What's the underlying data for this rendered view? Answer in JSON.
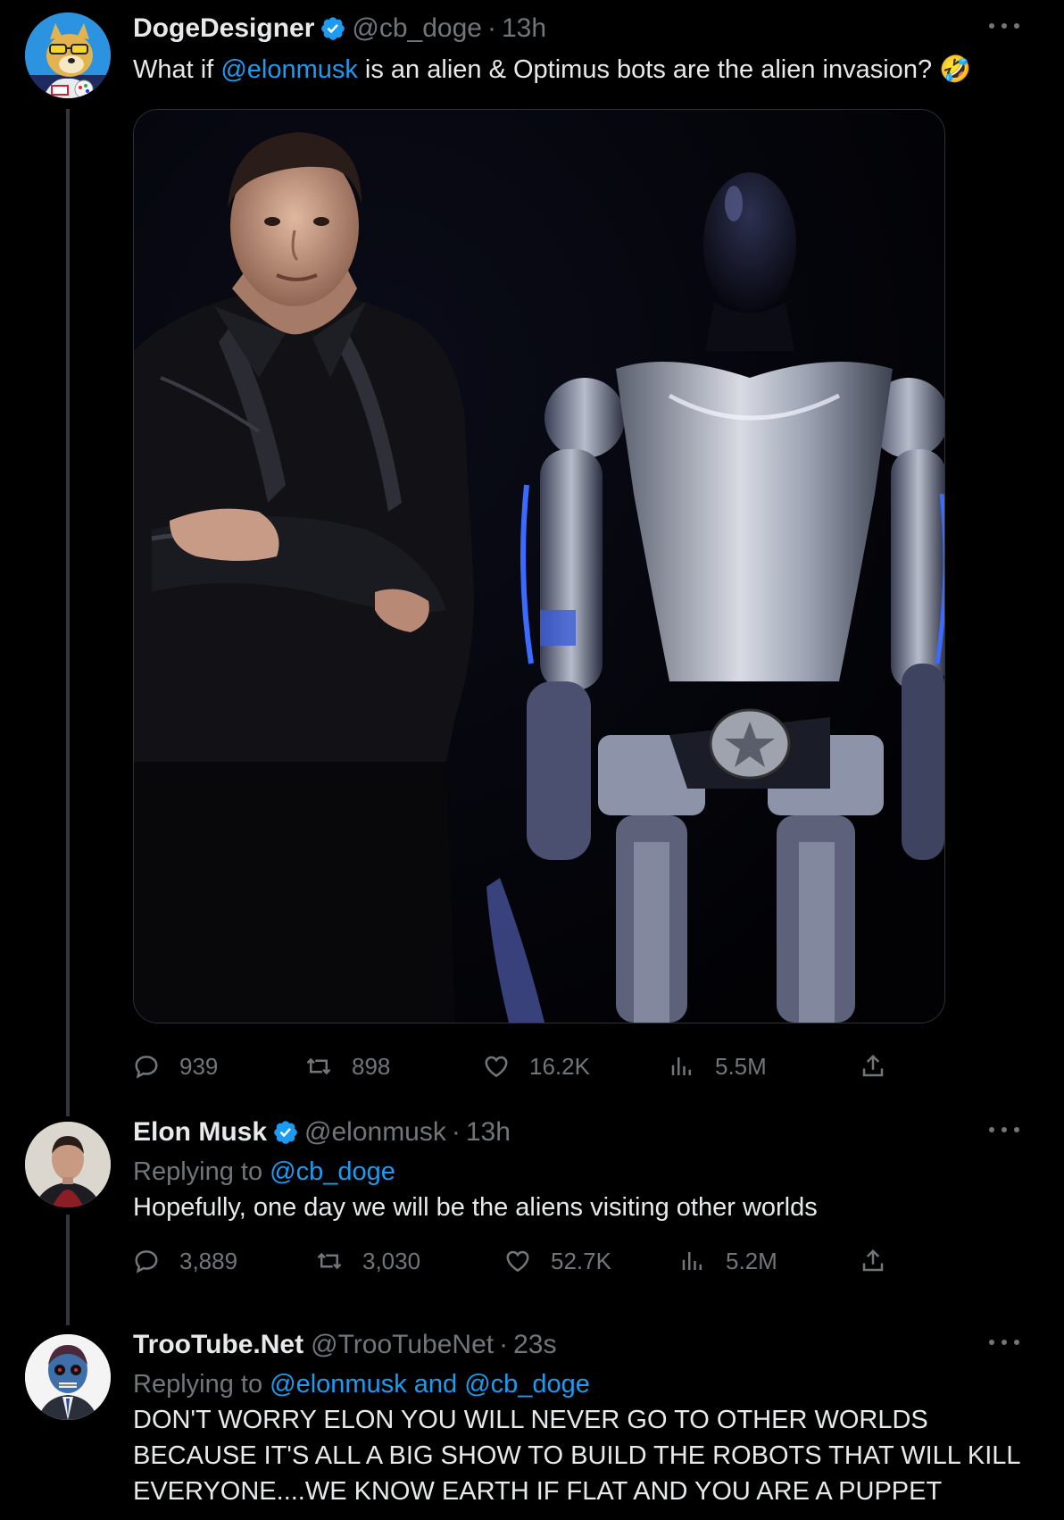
{
  "tweets": [
    {
      "display_name": "DogeDesigner",
      "handle": "@cb_doge",
      "separator": "·",
      "time": "13h",
      "text_before": "What if ",
      "text_mention": "@elonmusk",
      "text_after": " is an alien & Optimus bots are the alien invasion? ",
      "emoji": "🤣",
      "stats": {
        "replies": "939",
        "retweets": "898",
        "likes": "16.2K",
        "views": "5.5M"
      }
    },
    {
      "display_name": "Elon Musk",
      "handle": "@elonmusk",
      "separator": "·",
      "time": "13h",
      "replying_label": "Replying to ",
      "replying_to": "@cb_doge",
      "text": "Hopefully, one day we will be the aliens visiting other worlds",
      "stats": {
        "replies": "3,889",
        "retweets": "3,030",
        "likes": "52.7K",
        "views": "5.2M"
      }
    },
    {
      "display_name": "TrooTube.Net",
      "handle": "@TrooTubeNet",
      "separator": "·",
      "time": "23s",
      "replying_label": "Replying to ",
      "replying_to": "@elonmusk and @cb_doge",
      "text_lines": [
        "DON'T WORRY ELON YOU WILL NEVER GO TO OTHER WORLDS",
        "BECAUSE IT'S ALL A BIG SHOW TO BUILD THE ROBOTS THAT WILL KILL",
        "EVERYONE....WE KNOW EARTH IF FLAT AND YOU ARE A PUPPET"
      ]
    }
  ],
  "colors": {
    "background": "#000000",
    "link": "#1d9bf0",
    "muted": "#71767b",
    "text": "#e7e9ea",
    "verified": "#1d9bf0"
  },
  "icons": [
    "verified-icon",
    "more-icon",
    "reply-icon",
    "retweet-icon",
    "like-icon",
    "views-icon",
    "share-icon"
  ]
}
